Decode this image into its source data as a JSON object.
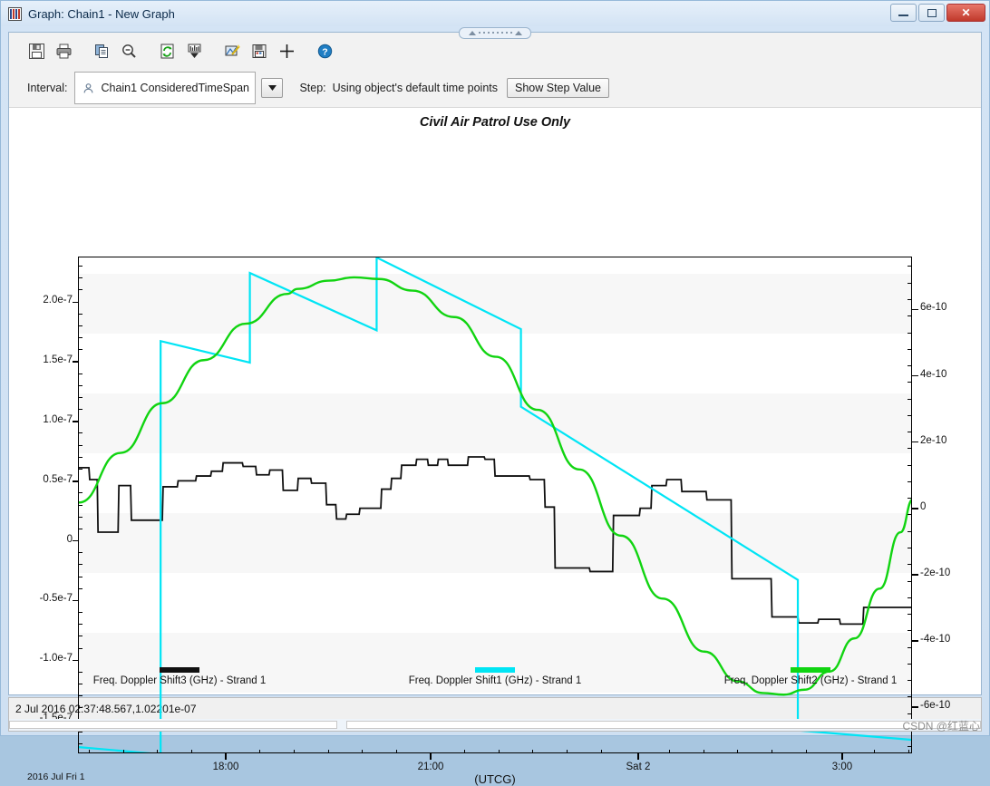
{
  "window": {
    "title": "Graph:  Chain1 - New Graph",
    "icon": "graph-bars-icon",
    "minimize_label": "Minimize",
    "restore_label": "Restore",
    "close_label": "Close"
  },
  "toolbar": {
    "buttons": [
      {
        "name": "save-icon",
        "label": "Save"
      },
      {
        "name": "print-icon",
        "label": "Print"
      },
      {
        "name": "copy-icon",
        "label": "Copy"
      },
      {
        "name": "zoom-out-icon",
        "label": "Zoom Out"
      },
      {
        "name": "refresh-icon",
        "label": "Refresh"
      },
      {
        "name": "chart-export-icon",
        "label": "Export Chart"
      },
      {
        "name": "wand-icon",
        "label": "Properties"
      },
      {
        "name": "save-data-icon",
        "label": "Save Data"
      },
      {
        "name": "crosshair-icon",
        "label": "Crosshair"
      },
      {
        "name": "help-icon",
        "label": "Help"
      }
    ]
  },
  "interval_bar": {
    "interval_label": "Interval:",
    "interval_value": "Chain1 ConsideredTimeSpan",
    "interval_icon": "object-person-icon",
    "dropdown_icon": "chevron-down-icon",
    "step_label": "Step:",
    "step_value": "Using object's default time points",
    "show_step_button": "Show Step Value"
  },
  "status": {
    "readout": "2 Jul 2016 02:37:48.567,1.02201e-07",
    "watermark": "CSDN @红蓝心"
  },
  "colors": {
    "series_black": "#111111",
    "series_cyan": "#00e5f5",
    "series_green": "#11d411",
    "band": "#f7f7f7",
    "axis": "#000000"
  },
  "chart_data": {
    "type": "line",
    "title": "Civil Air Patrol Use Only",
    "xlabel": "(UTCG)",
    "x_start_caption": "2016 Jul Fri 1",
    "grid": true,
    "legend_position": "bottom",
    "x_ticks": [
      "18:00",
      "21:00",
      "Sat 2",
      "3:00"
    ],
    "x_tick_positions": [
      0.1772,
      0.4228,
      0.6717,
      0.9163
    ],
    "xlim_labels": [
      "2016 Jul Fri 1 16:45",
      "2016 Jul Sat 2 03:40"
    ],
    "y_left_label": "",
    "y_left_ticks": [
      "2.0e-7",
      "1.5e-7",
      "1.0e-7",
      "0.5e-7",
      "0",
      "-0.5e-7",
      "-1.0e-7",
      "-1.5e-7"
    ],
    "y_left_values": [
      2e-07,
      1.5e-07,
      1e-07,
      5e-08,
      0,
      -5e-08,
      -1e-07,
      -1.5e-07
    ],
    "ylim_left": [
      -1.78e-07,
      2.38e-07
    ],
    "y_right_label": "",
    "y_right_ticks": [
      "6e-10",
      "4e-10",
      "2e-10",
      "0",
      "-2e-10",
      "-4e-10",
      "-6e-10"
    ],
    "y_right_values": [
      6e-10,
      4e-10,
      2e-10,
      0,
      -2e-10,
      -4e-10,
      -6e-10
    ],
    "ylim_right": [
      -7.4e-10,
      7.6e-10
    ],
    "series": [
      {
        "name": "Freq. Doppler Shift3 (GHz) - Strand 1",
        "color": "#111111",
        "axis": "left",
        "style": "step",
        "points": [
          [
            0.0,
            0.62
          ],
          [
            0.012,
            0.62
          ],
          [
            0.013,
            0.52
          ],
          [
            0.022,
            0.52
          ],
          [
            0.023,
            0.08
          ],
          [
            0.047,
            0.08
          ],
          [
            0.048,
            0.47
          ],
          [
            0.062,
            0.47
          ],
          [
            0.063,
            0.18
          ],
          [
            0.1,
            0.18
          ],
          [
            0.101,
            0.46
          ],
          [
            0.118,
            0.46
          ],
          [
            0.119,
            0.51
          ],
          [
            0.14,
            0.51
          ],
          [
            0.141,
            0.55
          ],
          [
            0.158,
            0.55
          ],
          [
            0.159,
            0.59
          ],
          [
            0.172,
            0.59
          ],
          [
            0.173,
            0.66
          ],
          [
            0.196,
            0.66
          ],
          [
            0.197,
            0.63
          ],
          [
            0.212,
            0.63
          ],
          [
            0.213,
            0.56
          ],
          [
            0.228,
            0.56
          ],
          [
            0.229,
            0.6
          ],
          [
            0.244,
            0.6
          ],
          [
            0.245,
            0.43
          ],
          [
            0.262,
            0.43
          ],
          [
            0.263,
            0.53
          ],
          [
            0.278,
            0.53
          ],
          [
            0.279,
            0.49
          ],
          [
            0.296,
            0.49
          ],
          [
            0.297,
            0.31
          ],
          [
            0.308,
            0.31
          ],
          [
            0.309,
            0.19
          ],
          [
            0.32,
            0.19
          ],
          [
            0.321,
            0.23
          ],
          [
            0.336,
            0.23
          ],
          [
            0.337,
            0.28
          ],
          [
            0.362,
            0.28
          ],
          [
            0.363,
            0.44
          ],
          [
            0.374,
            0.44
          ],
          [
            0.375,
            0.53
          ],
          [
            0.386,
            0.53
          ],
          [
            0.387,
            0.64
          ],
          [
            0.404,
            0.64
          ],
          [
            0.405,
            0.69
          ],
          [
            0.418,
            0.69
          ],
          [
            0.419,
            0.64
          ],
          [
            0.43,
            0.64
          ],
          [
            0.431,
            0.69
          ],
          [
            0.442,
            0.69
          ],
          [
            0.443,
            0.64
          ],
          [
            0.466,
            0.64
          ],
          [
            0.467,
            0.71
          ],
          [
            0.486,
            0.71
          ],
          [
            0.487,
            0.69
          ],
          [
            0.498,
            0.69
          ],
          [
            0.499,
            0.55
          ],
          [
            0.54,
            0.55
          ],
          [
            0.541,
            0.52
          ],
          [
            0.558,
            0.52
          ],
          [
            0.559,
            0.29
          ],
          [
            0.57,
            0.29
          ],
          [
            0.571,
            -0.22
          ],
          [
            0.612,
            -0.22
          ],
          [
            0.613,
            -0.25
          ],
          [
            0.64,
            -0.25
          ],
          [
            0.641,
            0.22
          ],
          [
            0.672,
            0.22
          ],
          [
            0.673,
            0.28
          ],
          [
            0.686,
            0.28
          ],
          [
            0.687,
            0.47
          ],
          [
            0.704,
            0.47
          ],
          [
            0.705,
            0.52
          ],
          [
            0.722,
            0.52
          ],
          [
            0.723,
            0.42
          ],
          [
            0.752,
            0.42
          ],
          [
            0.753,
            0.35
          ],
          [
            0.782,
            0.35
          ],
          [
            0.783,
            -0.31
          ],
          [
            0.83,
            -0.31
          ],
          [
            0.831,
            -0.63
          ],
          [
            0.862,
            -0.63
          ],
          [
            0.863,
            -0.68
          ],
          [
            0.886,
            -0.68
          ],
          [
            0.887,
            -0.65
          ],
          [
            0.912,
            -0.65
          ],
          [
            0.913,
            -0.69
          ],
          [
            0.94,
            -0.69
          ],
          [
            0.941,
            -0.55
          ],
          [
            1.0,
            -0.55
          ]
        ],
        "note": "y values in units of 1e-7"
      },
      {
        "name": "Freq. Doppler Shift1 (GHz) - Strand 1",
        "color": "#00e5f5",
        "axis": "left",
        "style": "sawtooth",
        "segments": [
          [
            [
              0.0,
              -1.72
            ],
            [
              0.098,
              -1.78
            ]
          ],
          [
            [
              0.098,
              1.68
            ],
            [
              0.205,
              1.5
            ]
          ],
          [
            [
              0.205,
              2.25
            ],
            [
              0.357,
              1.77
            ]
          ],
          [
            [
              0.357,
              2.38
            ],
            [
              0.53,
              1.78
            ]
          ],
          [
            [
              0.53,
              1.13
            ],
            [
              0.862,
              -0.32
            ]
          ],
          [
            [
              0.862,
              -1.58
            ],
            [
              1.0,
              -1.66
            ]
          ]
        ],
        "note": "y values in units of 1e-7"
      },
      {
        "name": "Freq. Doppler Shift2 (GHz) - Strand 1",
        "color": "#11d411",
        "axis": "right",
        "style": "sine",
        "points": [
          [
            0.0,
            0.02
          ],
          [
            0.05,
            0.17
          ],
          [
            0.1,
            0.32
          ],
          [
            0.15,
            0.45
          ],
          [
            0.2,
            0.56
          ],
          [
            0.25,
            0.65
          ],
          [
            0.262,
            0.665
          ],
          [
            0.3,
            0.69
          ],
          [
            0.33,
            0.7
          ],
          [
            0.36,
            0.695
          ],
          [
            0.4,
            0.66
          ],
          [
            0.45,
            0.58
          ],
          [
            0.5,
            0.46
          ],
          [
            0.55,
            0.3
          ],
          [
            0.6,
            0.12
          ],
          [
            0.65,
            -0.08
          ],
          [
            0.7,
            -0.27
          ],
          [
            0.75,
            -0.43
          ],
          [
            0.79,
            -0.52
          ],
          [
            0.82,
            -0.555
          ],
          [
            0.845,
            -0.56
          ],
          [
            0.87,
            -0.545
          ],
          [
            0.9,
            -0.49
          ],
          [
            0.93,
            -0.39
          ],
          [
            0.96,
            -0.24
          ],
          [
            0.985,
            -0.07
          ],
          [
            1.0,
            0.03
          ]
        ],
        "note": "y values in units of 1e-9"
      }
    ]
  }
}
